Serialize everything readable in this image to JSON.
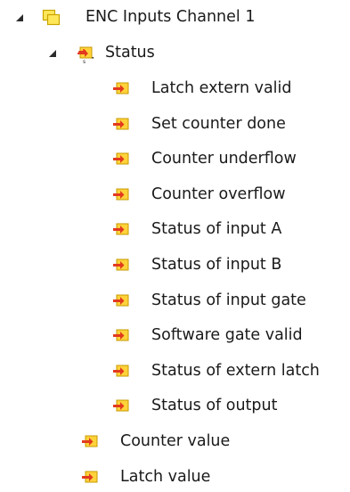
{
  "tree": {
    "root": {
      "label": "ENC Inputs Channel 1",
      "expanded": true,
      "icon": "input-channel-icon"
    },
    "status_group": {
      "label": "Status",
      "expanded": true,
      "icon": "input-variable-icon"
    },
    "status_items": [
      {
        "label": "Latch extern valid"
      },
      {
        "label": "Set counter done"
      },
      {
        "label": "Counter underflow"
      },
      {
        "label": "Counter overflow"
      },
      {
        "label": "Status of input A"
      },
      {
        "label": "Status of input B"
      },
      {
        "label": "Status of input gate"
      },
      {
        "label": "Software gate valid"
      },
      {
        "label": "Status of extern latch"
      },
      {
        "label": "Status of output"
      }
    ],
    "channel_items": [
      {
        "label": "Counter value"
      },
      {
        "label": "Latch value"
      }
    ]
  },
  "colors": {
    "channel_icon_fill": "#ffe75a",
    "channel_icon_border": "#c9a400",
    "variable_icon_fill": "#ffd23a",
    "variable_icon_arrow": "#e23a1e",
    "expander": "#2b2b2b"
  }
}
